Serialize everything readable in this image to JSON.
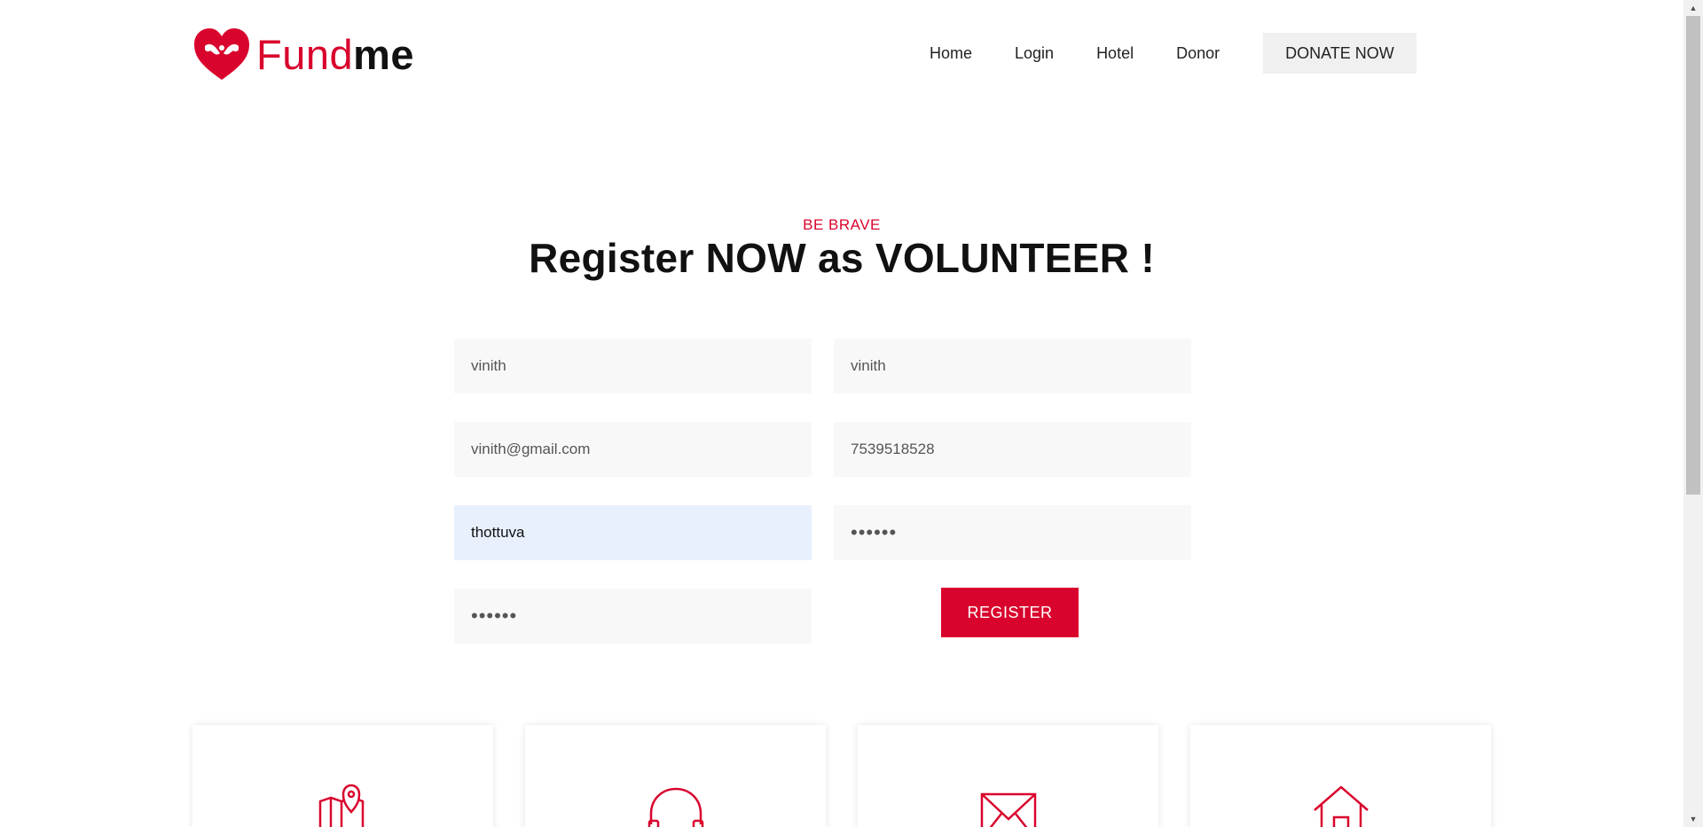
{
  "brand": {
    "name_part1": "Fund",
    "name_part2": "me",
    "logo_icon": "heart-hands-icon"
  },
  "nav": {
    "items": [
      {
        "label": "Home"
      },
      {
        "label": "Login"
      },
      {
        "label": "Hotel"
      },
      {
        "label": "Donor"
      }
    ],
    "cta_label": "DONATE NOW"
  },
  "hero": {
    "eyebrow": "BE BRAVE",
    "title": "Register NOW as VOLUNTEER !"
  },
  "form": {
    "first_name": "vinith",
    "last_name": "vinith",
    "email": "vinith@gmail.com",
    "phone": "7539518528",
    "address": "thottuva",
    "password": "••••••",
    "confirm_password": "••••••",
    "submit_label": "REGISTER"
  },
  "cards": [
    {
      "icon": "map-pin-icon"
    },
    {
      "icon": "headphones-icon"
    },
    {
      "icon": "envelope-icon"
    },
    {
      "icon": "home-icon"
    }
  ],
  "colors": {
    "accent": "#d9042d",
    "text": "#111111",
    "field_bg": "#f8f8f8",
    "autofill_bg": "#e8f0fe"
  }
}
